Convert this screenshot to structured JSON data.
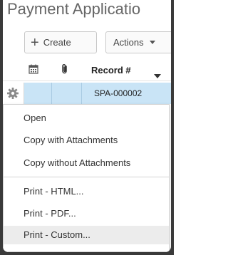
{
  "page": {
    "title": "Payment Applicatio"
  },
  "toolbar": {
    "create_label": "Create",
    "actions_label": "Actions"
  },
  "grid": {
    "columns": {
      "record": "Record #"
    },
    "rows": [
      {
        "record": "SPA-000002"
      }
    ]
  },
  "context_menu": {
    "items": [
      "Open",
      "Copy with Attachments",
      "Copy without Attachments",
      "Print - HTML...",
      "Print - PDF...",
      "Print - Custom..."
    ],
    "active_item": "Print - Custom..."
  },
  "icons": {
    "create": "plus-icon",
    "actions": "chevron-down-icon",
    "date_column": "calendar-icon",
    "attachment_column": "paperclip-icon",
    "row_menu": "gear-icon"
  }
}
